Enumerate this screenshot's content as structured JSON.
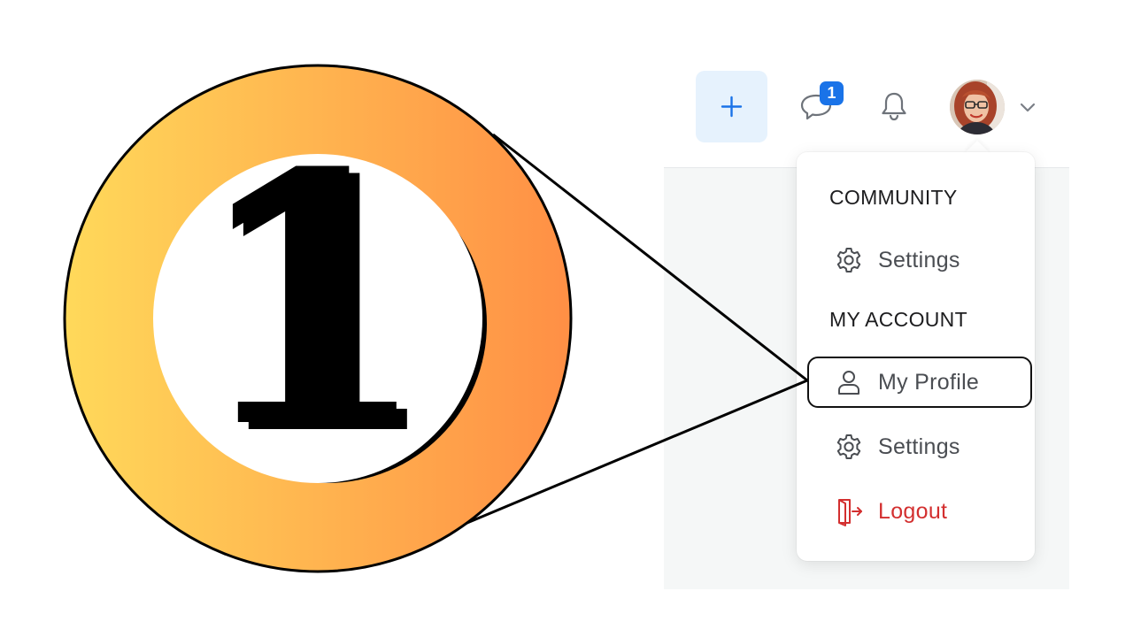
{
  "callout": {
    "step_number": "1",
    "gradient_start": "#ffd95a",
    "gradient_end": "#ff8f45"
  },
  "topbar": {
    "add_icon": "plus-icon",
    "chat_icon": "chat-bubble-icon",
    "chat_badge_count": "1",
    "bell_icon": "bell-icon",
    "avatar": "user-avatar",
    "chevron_icon": "chevron-down-icon",
    "accent": "#1a73e8"
  },
  "dropdown": {
    "sections": [
      {
        "title": "COMMUNITY",
        "items": [
          {
            "label": "Settings",
            "icon": "gear-icon"
          }
        ]
      },
      {
        "title": "MY ACCOUNT",
        "items": [
          {
            "label": "My Profile",
            "icon": "person-icon",
            "highlighted": true
          },
          {
            "label": "Settings",
            "icon": "gear-icon"
          },
          {
            "label": "Logout",
            "icon": "logout-icon",
            "color": "#d32f2f"
          }
        ]
      }
    ]
  }
}
